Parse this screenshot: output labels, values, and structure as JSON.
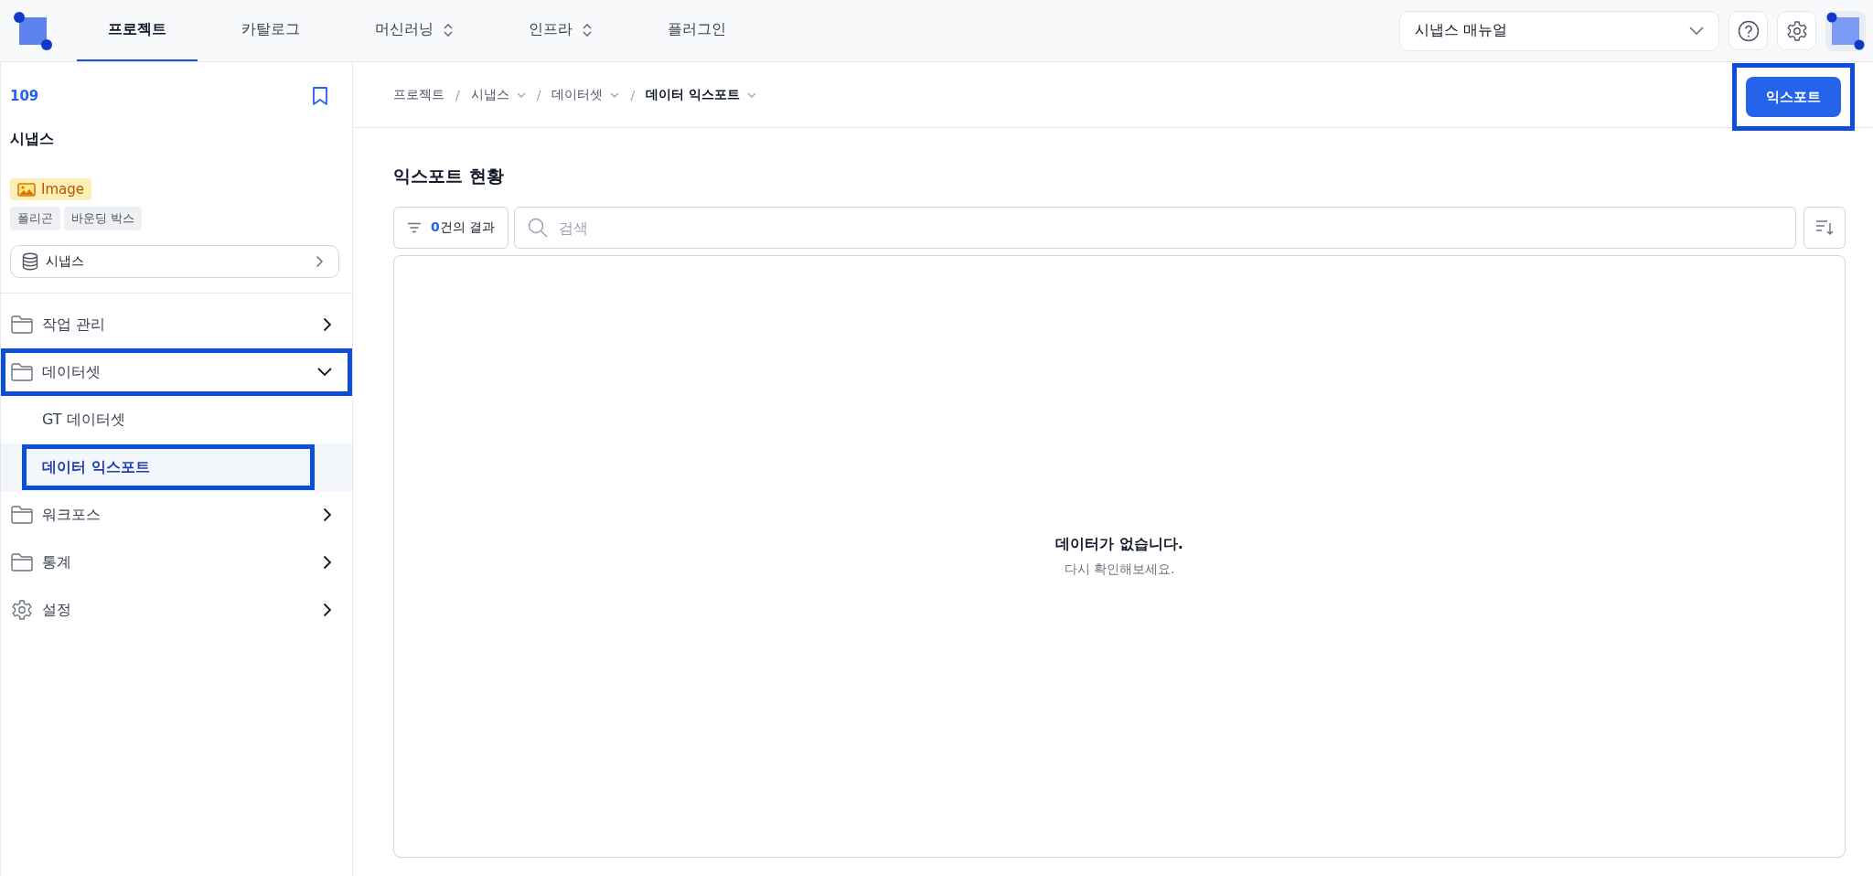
{
  "top_nav": {
    "tabs": [
      {
        "label": "프로젝트",
        "selected": true,
        "dropdown": false
      },
      {
        "label": "카탈로그",
        "selected": false,
        "dropdown": false
      },
      {
        "label": "머신러닝",
        "selected": false,
        "dropdown": true
      },
      {
        "label": "인프라",
        "selected": false,
        "dropdown": true
      },
      {
        "label": "플러그인",
        "selected": false,
        "dropdown": false
      }
    ],
    "manual_select": {
      "value": "시냅스 매뉴얼"
    }
  },
  "sidebar": {
    "project_id": "109",
    "project_name": "시냅스",
    "data_type": "Image",
    "tags": [
      "폴리곤",
      "바운딩 박스"
    ],
    "dataset_button": "시냅스",
    "items": [
      {
        "kind": "folder",
        "label": "작업 관리",
        "expanded": false,
        "highlighted": false
      },
      {
        "kind": "folder",
        "label": "데이터셋",
        "expanded": true,
        "highlighted": true,
        "children": [
          {
            "label": "GT 데이터셋",
            "selected": false,
            "highlighted": false
          },
          {
            "label": "데이터 익스포트",
            "selected": true,
            "highlighted": true
          }
        ]
      },
      {
        "kind": "folder",
        "label": "워크포스",
        "expanded": false,
        "highlighted": false
      },
      {
        "kind": "folder",
        "label": "통계",
        "expanded": false,
        "highlighted": false
      },
      {
        "kind": "settings",
        "label": "설정",
        "expanded": false,
        "highlighted": false
      }
    ]
  },
  "breadcrumb": [
    {
      "label": "프로젝트",
      "dropdown": false,
      "current": false
    },
    {
      "separator": "/",
      "label": "시냅스",
      "dropdown": true,
      "current": false
    },
    {
      "separator": "/",
      "label": "데이터셋",
      "dropdown": true,
      "current": false
    },
    {
      "separator": "/",
      "label": "데이터 익스포트",
      "dropdown": true,
      "current": true
    }
  ],
  "export_button": {
    "label": "익스포트",
    "highlighted": true
  },
  "page_title": "익스포트 현황",
  "filter": {
    "count": "0",
    "suffix": "건의 결과"
  },
  "search": {
    "placeholder": "검색"
  },
  "empty_state": {
    "title": "데이터가 없습니다.",
    "subtitle": "다시 확인해보세요."
  }
}
